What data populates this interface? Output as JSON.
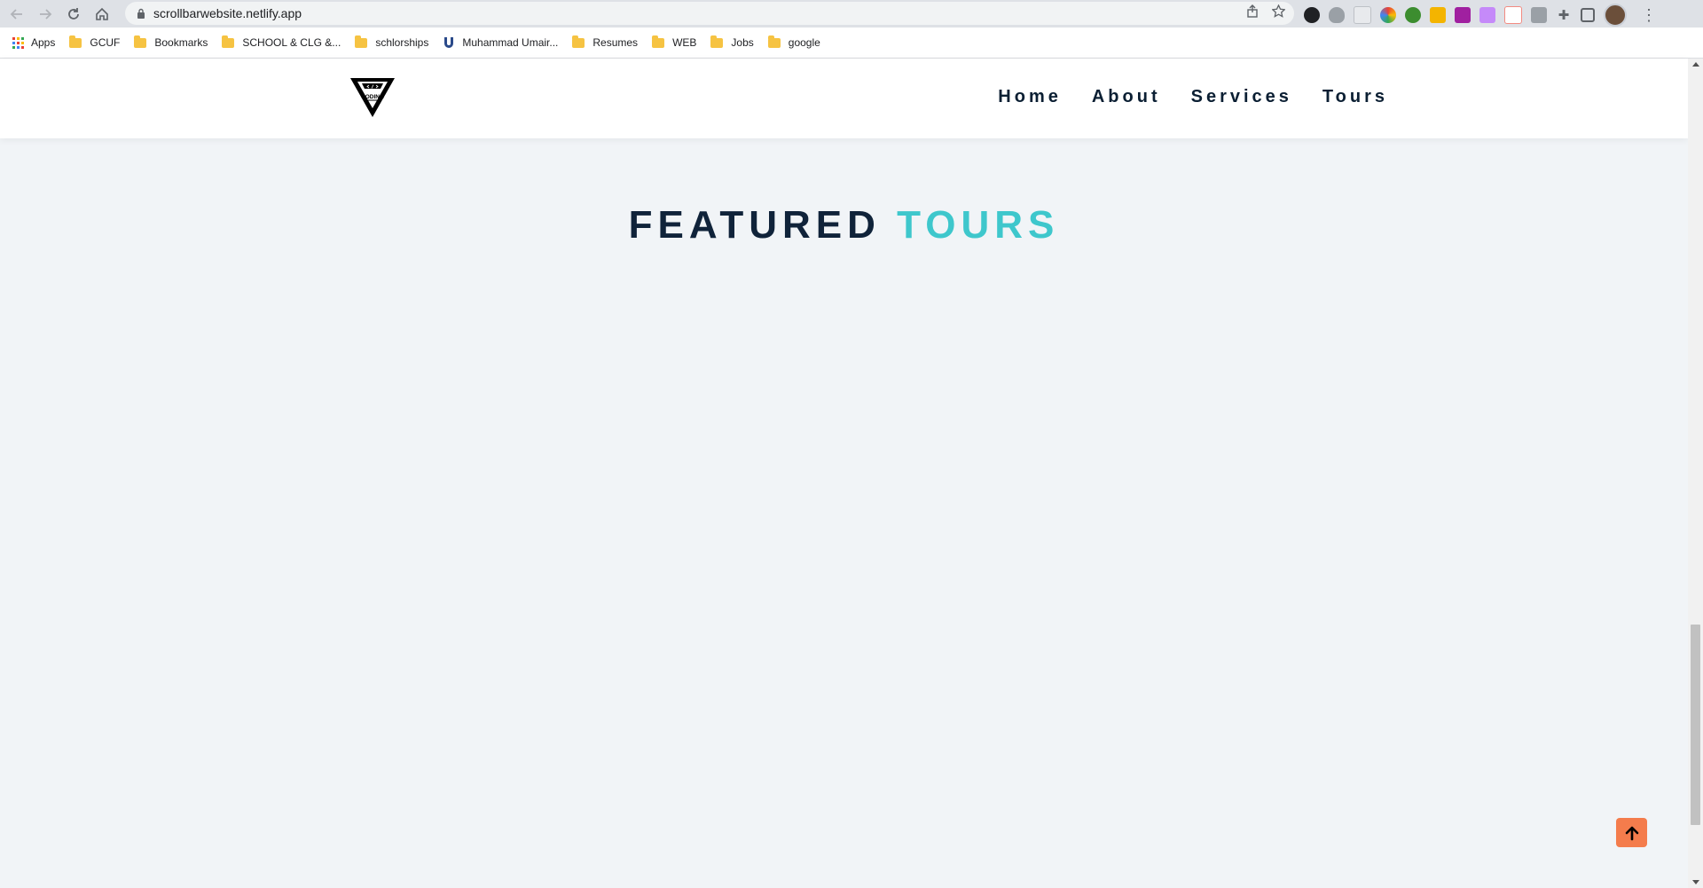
{
  "browser": {
    "url": "scrollbarwebsite.netlify.app",
    "bookmarks": [
      "Apps",
      "GCUF",
      "Bookmarks",
      "SCHOOL & CLG &...",
      "schlorships",
      "Muhammad Umair...",
      "Resumes",
      "WEB",
      "Jobs",
      "google"
    ]
  },
  "site": {
    "logo_text": "CODING",
    "nav": [
      "Home",
      "About",
      "Services",
      "Tours"
    ],
    "section_title_part1": "FEATURED",
    "section_title_part2": "TOURS"
  },
  "colors": {
    "accent": "#3ec7cc",
    "heading": "#10233a",
    "scroll_button": "#f47c4c",
    "page_bg": "#f1f4f7"
  },
  "icons": {
    "scroll_top": "arrow-up-icon"
  }
}
